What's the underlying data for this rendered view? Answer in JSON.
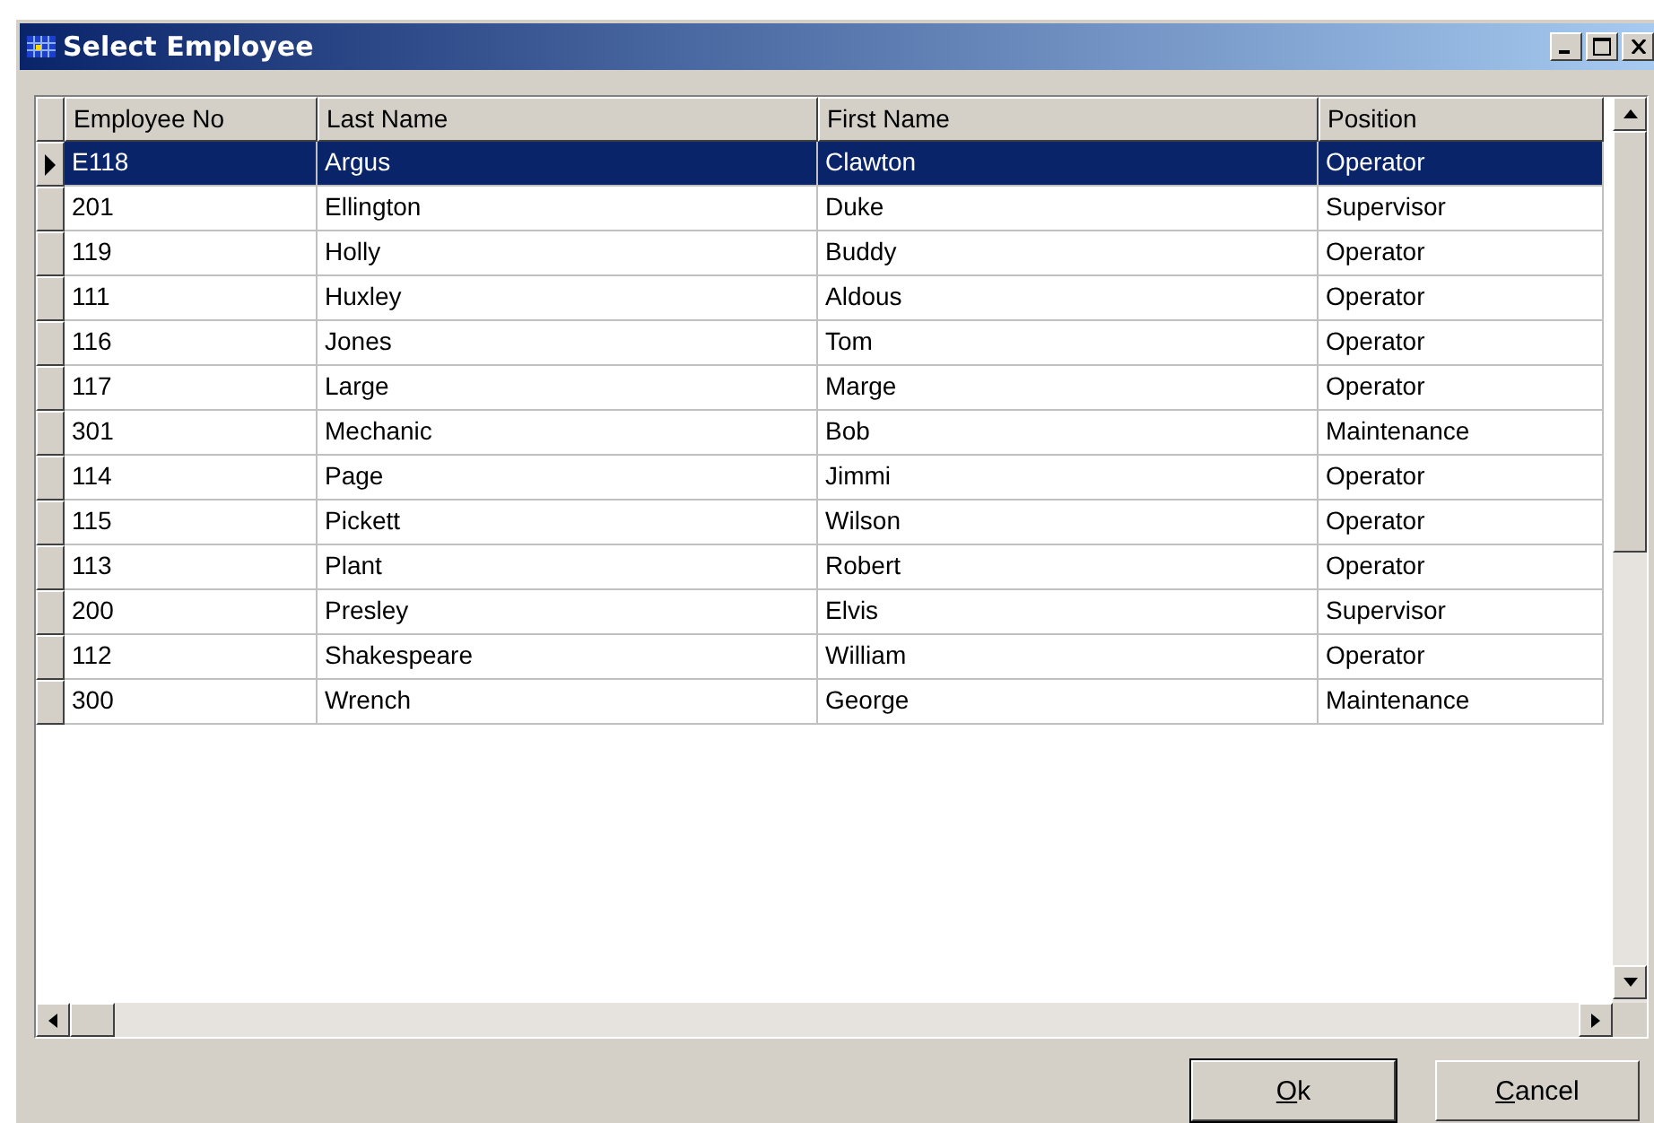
{
  "window": {
    "title": "Select Employee"
  },
  "table": {
    "columns": [
      "Employee No",
      "Last Name",
      "First Name",
      "Position"
    ],
    "rows": [
      {
        "cells": [
          "E118",
          "Argus",
          "Clawton",
          "Operator"
        ],
        "selected": true
      },
      {
        "cells": [
          "201",
          "Ellington",
          "Duke",
          "Supervisor"
        ],
        "selected": false
      },
      {
        "cells": [
          "119",
          "Holly",
          "Buddy",
          "Operator"
        ],
        "selected": false
      },
      {
        "cells": [
          "111",
          "Huxley",
          "Aldous",
          "Operator"
        ],
        "selected": false
      },
      {
        "cells": [
          "116",
          "Jones",
          "Tom",
          "Operator"
        ],
        "selected": false
      },
      {
        "cells": [
          "117",
          "Large",
          "Marge",
          "Operator"
        ],
        "selected": false
      },
      {
        "cells": [
          "301",
          "Mechanic",
          "Bob",
          "Maintenance"
        ],
        "selected": false
      },
      {
        "cells": [
          "114",
          "Page",
          "Jimmi",
          "Operator"
        ],
        "selected": false
      },
      {
        "cells": [
          "115",
          "Pickett",
          "Wilson",
          "Operator"
        ],
        "selected": false
      },
      {
        "cells": [
          "113",
          "Plant",
          "Robert",
          "Operator"
        ],
        "selected": false
      },
      {
        "cells": [
          "200",
          "Presley",
          "Elvis",
          "Supervisor"
        ],
        "selected": false
      },
      {
        "cells": [
          "112",
          "Shakespeare",
          "William",
          "Operator"
        ],
        "selected": false
      },
      {
        "cells": [
          "300",
          "Wrench",
          "George",
          "Maintenance"
        ],
        "selected": false
      }
    ]
  },
  "buttons": [
    {
      "label": "Ok",
      "underline_first": true,
      "default": true
    },
    {
      "label": "Cancel",
      "underline_first": true,
      "default": false
    }
  ]
}
